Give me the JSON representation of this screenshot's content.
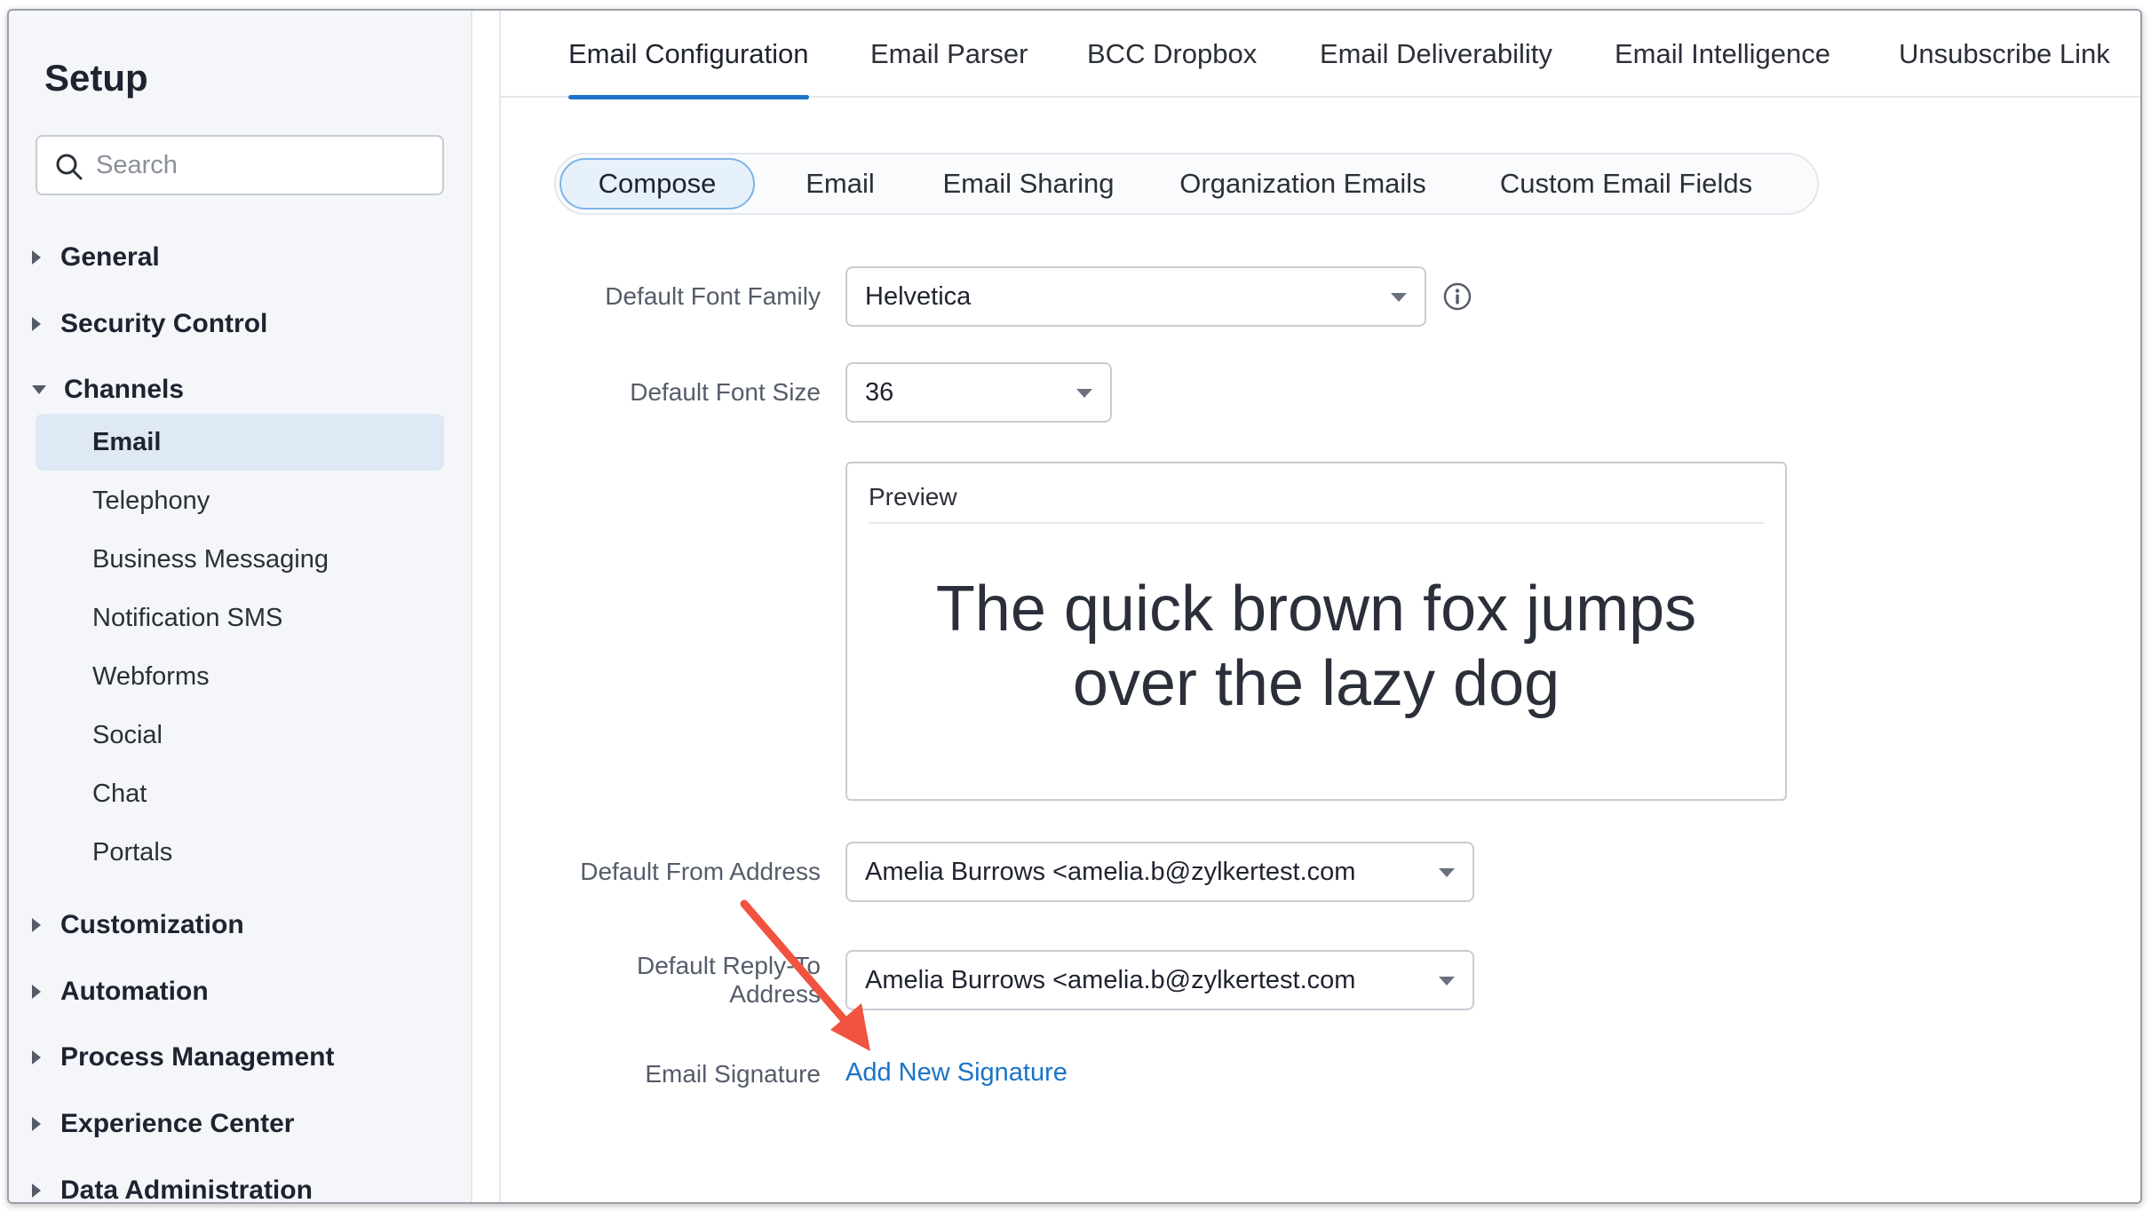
{
  "sidebar": {
    "title": "Setup",
    "search_placeholder": "Search",
    "groups": [
      {
        "label": "General",
        "expanded": false
      },
      {
        "label": "Security Control",
        "expanded": false
      },
      {
        "label": "Channels",
        "expanded": true
      },
      {
        "label": "Customization",
        "expanded": false
      },
      {
        "label": "Automation",
        "expanded": false
      },
      {
        "label": "Process Management",
        "expanded": false
      },
      {
        "label": "Experience Center",
        "expanded": false
      },
      {
        "label": "Data Administration",
        "expanded": false
      }
    ],
    "channel_items": [
      {
        "label": "Email",
        "active": true
      },
      {
        "label": "Telephony"
      },
      {
        "label": "Business Messaging"
      },
      {
        "label": "Notification SMS"
      },
      {
        "label": "Webforms"
      },
      {
        "label": "Social"
      },
      {
        "label": "Chat"
      },
      {
        "label": "Portals"
      }
    ]
  },
  "top_tabs": [
    {
      "label": "Email Configuration",
      "active": true
    },
    {
      "label": "Email Parser"
    },
    {
      "label": "BCC Dropbox"
    },
    {
      "label": "Email Deliverability"
    },
    {
      "label": "Email Intelligence"
    },
    {
      "label": "Unsubscribe Link"
    }
  ],
  "sub_tabs": [
    {
      "label": "Compose",
      "active": true
    },
    {
      "label": "Email"
    },
    {
      "label": "Email Sharing"
    },
    {
      "label": "Organization Emails"
    },
    {
      "label": "Custom Email Fields"
    }
  ],
  "form": {
    "font_family": {
      "label": "Default Font Family",
      "value": "Helvetica"
    },
    "font_size": {
      "label": "Default Font Size",
      "value": "36"
    },
    "preview": {
      "label": "Preview",
      "text_line1": "The quick brown fox jumps",
      "text_line2": "over the lazy dog"
    },
    "from_address": {
      "label": "Default From Address",
      "value": "Amelia Burrows <amelia.b@zylkertest.com"
    },
    "reply_to": {
      "label_line1": "Default Reply-To",
      "label_line2": "Address",
      "value": "Amelia Burrows <amelia.b@zylkertest.com"
    },
    "signature": {
      "label": "Email Signature",
      "link": "Add New Signature"
    }
  },
  "colors": {
    "accent": "#1a73c8",
    "annotation_arrow": "#f0533f"
  }
}
